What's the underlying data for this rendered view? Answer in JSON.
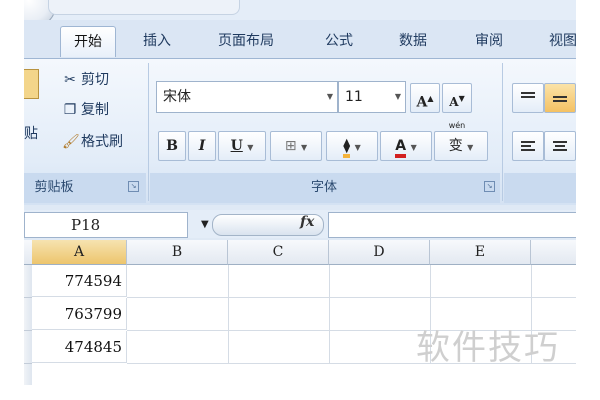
{
  "ribbon": {
    "tabs": [
      "开始",
      "插入",
      "页面布局",
      "公式",
      "数据",
      "审阅",
      "视图"
    ],
    "clipboard": {
      "paste_label": "贴",
      "cut_label": "剪切",
      "copy_label": "复制",
      "format_painter_label": "格式刷",
      "group_label": "剪贴板"
    },
    "font": {
      "font_name": "宋体",
      "font_size": "11",
      "group_label": "字体",
      "bold": "B",
      "italic": "I",
      "underline": "U",
      "grow_font": "A",
      "shrink_font": "A",
      "font_color_glyph": "A",
      "phonetic_glyph": "变",
      "phonetic_top": "wén"
    }
  },
  "formula_bar": {
    "name_box": "P18",
    "fx": "fx",
    "formula": ""
  },
  "sheet": {
    "columns": [
      "A",
      "B",
      "C",
      "D",
      "E"
    ],
    "selected_column": "A",
    "rows": [
      {
        "A": "774594"
      },
      {
        "A": "763799"
      },
      {
        "A": "474845"
      }
    ]
  },
  "watermark": "软件技巧",
  "colors": {
    "accent_fill": "#f4b33b",
    "font_red": "#d22020"
  }
}
